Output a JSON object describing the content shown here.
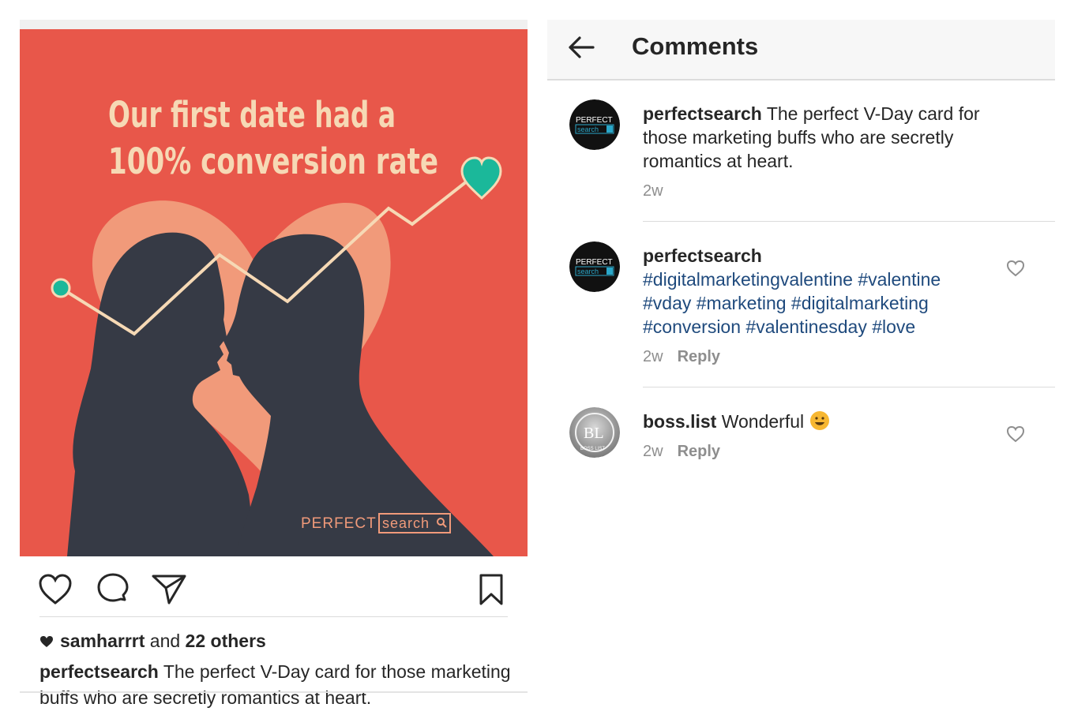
{
  "post": {
    "image": {
      "headline_line1": "Our first date had a",
      "headline_line2": "100% conversion rate",
      "brand_word": "PERFECT",
      "brand_box": "search",
      "colors": {
        "background": "#e8574a",
        "heart": "#f19a7a",
        "silhouette": "#363a45",
        "line": "#f6d9b5",
        "accent": "#1bb89a"
      }
    },
    "likes": {
      "user": "samharrrt",
      "connector": "and",
      "others": "22 others"
    },
    "caption": {
      "username": "perfectsearch",
      "text": "The perfect V-Day card for those marketing buffs who are secretly romantics at heart."
    }
  },
  "comments_panel": {
    "title": "Comments",
    "back_icon": "arrow-left-icon",
    "items": [
      {
        "username": "perfectsearch",
        "text": "The perfect V-Day card for those marketing buffs who are secretly romantics at heart.",
        "time": "2w",
        "avatar_line1": "PERFECT",
        "avatar_line2": "search"
      },
      {
        "username": "perfectsearch",
        "hashtags": "#digitalmarketingvalentine #valentine #vday #marketing #digitalmarketing #conversion #valentinesday #love",
        "time": "2w",
        "reply": "Reply",
        "avatar_line1": "PERFECT",
        "avatar_line2": "search"
      },
      {
        "username": "boss.list",
        "text": "Wonderful",
        "time": "2w",
        "reply": "Reply",
        "avatar_initials": "BL",
        "avatar_sub": "BOSS LIST"
      }
    ]
  }
}
